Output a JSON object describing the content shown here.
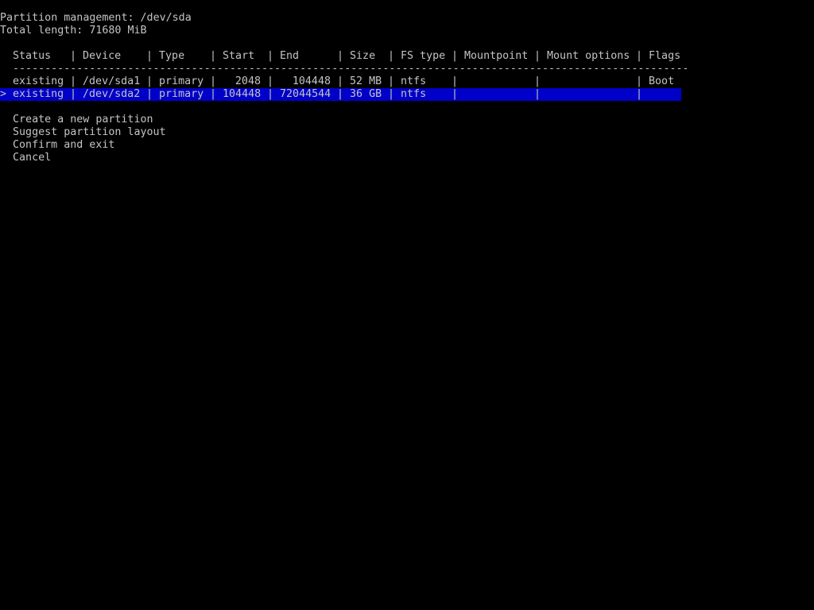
{
  "header": {
    "title": "Partition management: /dev/sda",
    "total_length": "Total length: 71680 MiB"
  },
  "table": {
    "columns": [
      "Status",
      "Device",
      "Type",
      "Start",
      "End",
      "Size",
      "FS type",
      "Mountpoint",
      "Mount options",
      "Flags"
    ],
    "divider": "------------------------------------------------------------------------------------------------------------------",
    "rows": [
      {
        "status": "existing",
        "device": "/dev/sda1",
        "type": "primary",
        "start": "2048",
        "end": "104448",
        "size": "52 MB",
        "fs_type": "ntfs",
        "mountpoint": "",
        "mount_options": "",
        "flags": "Boot",
        "selected": false
      },
      {
        "status": "existing",
        "device": "/dev/sda2",
        "type": "primary",
        "start": "104448",
        "end": "72044544",
        "size": "36 GB",
        "fs_type": "ntfs",
        "mountpoint": "",
        "mount_options": "",
        "flags": "",
        "selected": true
      }
    ],
    "selection_marker": ">",
    "column_separator": "|"
  },
  "menu": {
    "items": [
      "Create a new partition",
      "Suggest partition layout",
      "Confirm and exit",
      "Cancel"
    ]
  },
  "colors": {
    "background": "#000000",
    "text": "#c4c4c4",
    "selection": "#0000c8"
  }
}
